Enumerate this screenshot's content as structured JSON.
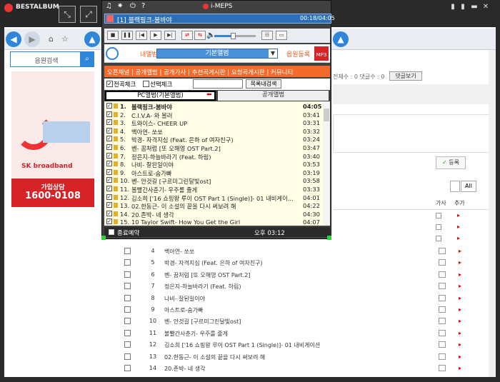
{
  "outer_window": {
    "title": "BESTALBUM"
  },
  "outer_nav": {
    "back_icon": "arrow-left",
    "forward_icon": "arrow-right",
    "home_icon": "home",
    "star_icon": "star"
  },
  "sidebar": {
    "search_label": "음원검색",
    "banner_logo": "SK broadband",
    "banner_sub": "가입상담",
    "banner_phone": "1600-0108"
  },
  "right_panel": {
    "stats": "전체수 : 0 댓글수 : 0",
    "reply_button": "댓글보기",
    "register_button": "등록",
    "all_button": "All",
    "col_lyrics": "가사",
    "col_add": "추가"
  },
  "background_list": [
    {
      "num": "4",
      "title": "백아연- 쏘쏘"
    },
    {
      "num": "5",
      "title": "박경- 자격지심 (Feat. 은하 of 여자친구)"
    },
    {
      "num": "6",
      "title": "벤- 꿈처럼 [또 오해영 OST Part.2]"
    },
    {
      "num": "7",
      "title": "정은지-하늘바라기 (Feat. 하림)"
    },
    {
      "num": "8",
      "title": "나비- 잘된일이야"
    },
    {
      "num": "9",
      "title": "아스트로-숨가빠"
    },
    {
      "num": "10",
      "title": "벤- 안것길 [구르미그린달빛ost]"
    },
    {
      "num": "11",
      "title": "볼빨간사춘기- 우주를 줄게"
    },
    {
      "num": "12",
      "title": "김소희 ['16 쇼핑왕 루이 OST Part 1 (Single)]- 01 내비게이션"
    },
    {
      "num": "13",
      "title": "02.한동근- 이 소설의 끝을 다시 써보려 해"
    },
    {
      "num": "14",
      "title": "20.존박- 네 생각"
    }
  ],
  "player": {
    "title": "i-MEPS",
    "now_playing": "[1] 블랙핑크-붐바야",
    "time": "00:18/04:05",
    "volume_fraction": 0.45,
    "tab_myalbum": "내앨범공개",
    "dropdown_value": "기본앨범",
    "tab_register": "음원등록",
    "mp3_label": "MP3",
    "orange_tabs": "오픈채널 | 공개앨범 | 공개가사 | 추천곡게시판 | 요청곡게시판 | 커뮤니티",
    "check_all": "전곡체크",
    "check_selected": "선택체크",
    "find_button": "목록내검색",
    "subtab_pc": "PC앨범(기본앨범)",
    "subtab_public": "공개앨범",
    "end_reservation": "종료예약",
    "clock": "오후  03:12",
    "songs": [
      {
        "n": "1.",
        "title": "블랙핑크-붐바야",
        "dur": "04:05",
        "active": true
      },
      {
        "n": "2.",
        "title": "C.I.V.A- 와 볼러",
        "dur": "03:41"
      },
      {
        "n": "3.",
        "title": "트와이스- CHEER UP",
        "dur": "03:31"
      },
      {
        "n": "4.",
        "title": "백아연- 쏘쏘",
        "dur": "03:32"
      },
      {
        "n": "5.",
        "title": "박경- 자격지심 (Feat. 은하 of 여자친구)",
        "dur": "03:24"
      },
      {
        "n": "6.",
        "title": "벤- 꿈처럼 [또 오해영 OST Part.2]",
        "dur": "03:47"
      },
      {
        "n": "7.",
        "title": "정은지-하늘바라기 (Feat. 하림)",
        "dur": "03:40"
      },
      {
        "n": "8.",
        "title": "나비- 잘된일이야",
        "dur": "03:53"
      },
      {
        "n": "9.",
        "title": "아스트로-숨가빠",
        "dur": "03:19"
      },
      {
        "n": "10.",
        "title": "벤- 안것길 [구르미그린달빛ost]",
        "dur": "03:58"
      },
      {
        "n": "11.",
        "title": "볼빨간사춘기- 우주를 줄게",
        "dur": "03:33"
      },
      {
        "n": "12.",
        "title": "김소희 ['16 쇼핑왕 루이 OST Part 1 (Single)]- 01 내비게이...",
        "dur": "04:01"
      },
      {
        "n": "13.",
        "title": "02.한동근- 이 소설의 끝을 다시 써보려 해",
        "dur": "04:22"
      },
      {
        "n": "14.",
        "title": "20.존박- 네 생각",
        "dur": "04:30"
      },
      {
        "n": "15.",
        "title": "10 Taylor Swift- How You Get the Girl",
        "dur": "04:07"
      }
    ]
  }
}
